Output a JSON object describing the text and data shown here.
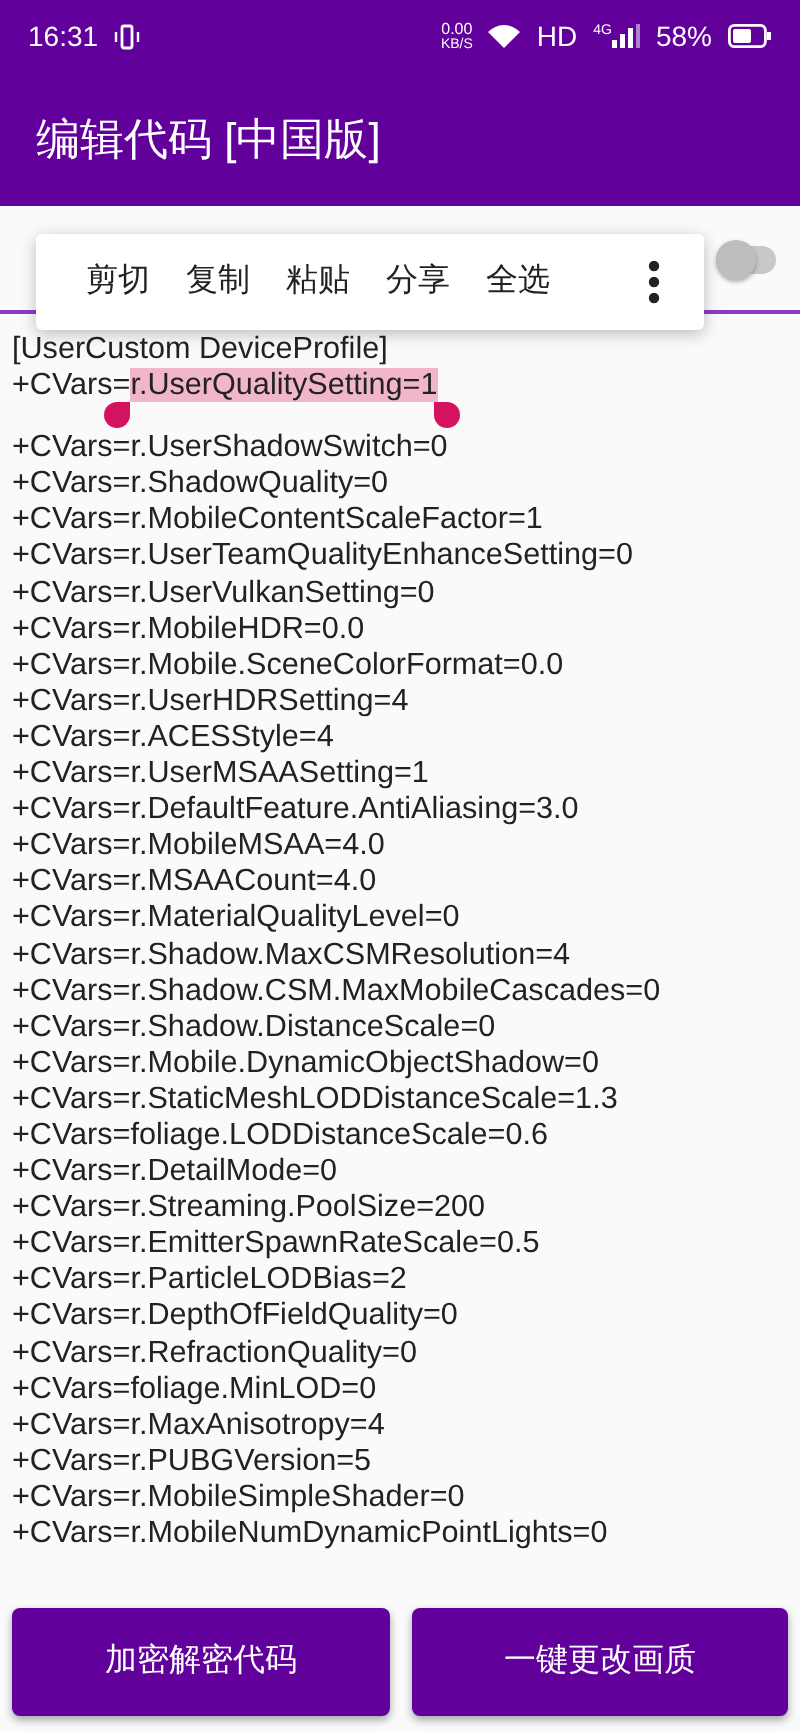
{
  "status_bar": {
    "time": "16:31",
    "speed": "0.00",
    "speed_unit": "KB/S",
    "hd": "HD",
    "network": "4G",
    "battery": "58%"
  },
  "app_bar": {
    "title": "编辑代码 [中国版]"
  },
  "switch": {
    "on": false
  },
  "context_menu": {
    "items": [
      "剪切",
      "复制",
      "粘贴",
      "分享",
      "全选"
    ]
  },
  "code_lines": [
    {
      "text": "[UserCustom DeviceProfile]"
    },
    {
      "text": "+CVars=",
      "highlighted": "r.UserQualitySetting=1"
    },
    {
      "text": "+CVars=r.UserShadowSwitch=0"
    },
    {
      "text": "+CVars=r.ShadowQuality=0"
    },
    {
      "text": "+CVars=r.MobileContentScaleFactor=1"
    },
    {
      "text": "+CVars=r.UserTeamQualityEnhanceSetting=0"
    },
    {
      "text": "+CVars=r.UserVulkanSetting=0"
    },
    {
      "text": "+CVars=r.MobileHDR=0.0"
    },
    {
      "text": "+CVars=r.Mobile.SceneColorFormat=0.0"
    },
    {
      "text": "+CVars=r.UserHDRSetting=4"
    },
    {
      "text": "+CVars=r.ACESStyle=4"
    },
    {
      "text": "+CVars=r.UserMSAASetting=1"
    },
    {
      "text": "+CVars=r.DefaultFeature.AntiAliasing=3.0"
    },
    {
      "text": "+CVars=r.MobileMSAA=4.0"
    },
    {
      "text": "+CVars=r.MSAACount=4.0"
    },
    {
      "text": "+CVars=r.MaterialQualityLevel=0"
    },
    {
      "text": "+CVars=r.Shadow.MaxCSMResolution=4"
    },
    {
      "text": "+CVars=r.Shadow.CSM.MaxMobileCascades=0"
    },
    {
      "text": "+CVars=r.Shadow.DistanceScale=0"
    },
    {
      "text": "+CVars=r.Mobile.DynamicObjectShadow=0"
    },
    {
      "text": "+CVars=r.StaticMeshLODDistanceScale=1.3"
    },
    {
      "text": "+CVars=foliage.LODDistanceScale=0.6"
    },
    {
      "text": "+CVars=r.DetailMode=0"
    },
    {
      "text": "+CVars=r.Streaming.PoolSize=200"
    },
    {
      "text": "+CVars=r.EmitterSpawnRateScale=0.5"
    },
    {
      "text": "+CVars=r.ParticleLODBias=2"
    },
    {
      "text": "+CVars=r.DepthOfFieldQuality=0"
    },
    {
      "text": "+CVars=r.RefractionQuality=0"
    },
    {
      "text": "+CVars=foliage.MinLOD=0"
    },
    {
      "text": "+CVars=r.MaxAnisotropy=4"
    },
    {
      "text": "+CVars=r.PUBGVersion=5"
    },
    {
      "text": "+CVars=r.MobileSimpleShader=0"
    },
    {
      "text": "+CVars=r.MobileNumDynamicPointLights=0"
    }
  ],
  "buttons": [
    "加密解密代码",
    "一键更改画质"
  ]
}
